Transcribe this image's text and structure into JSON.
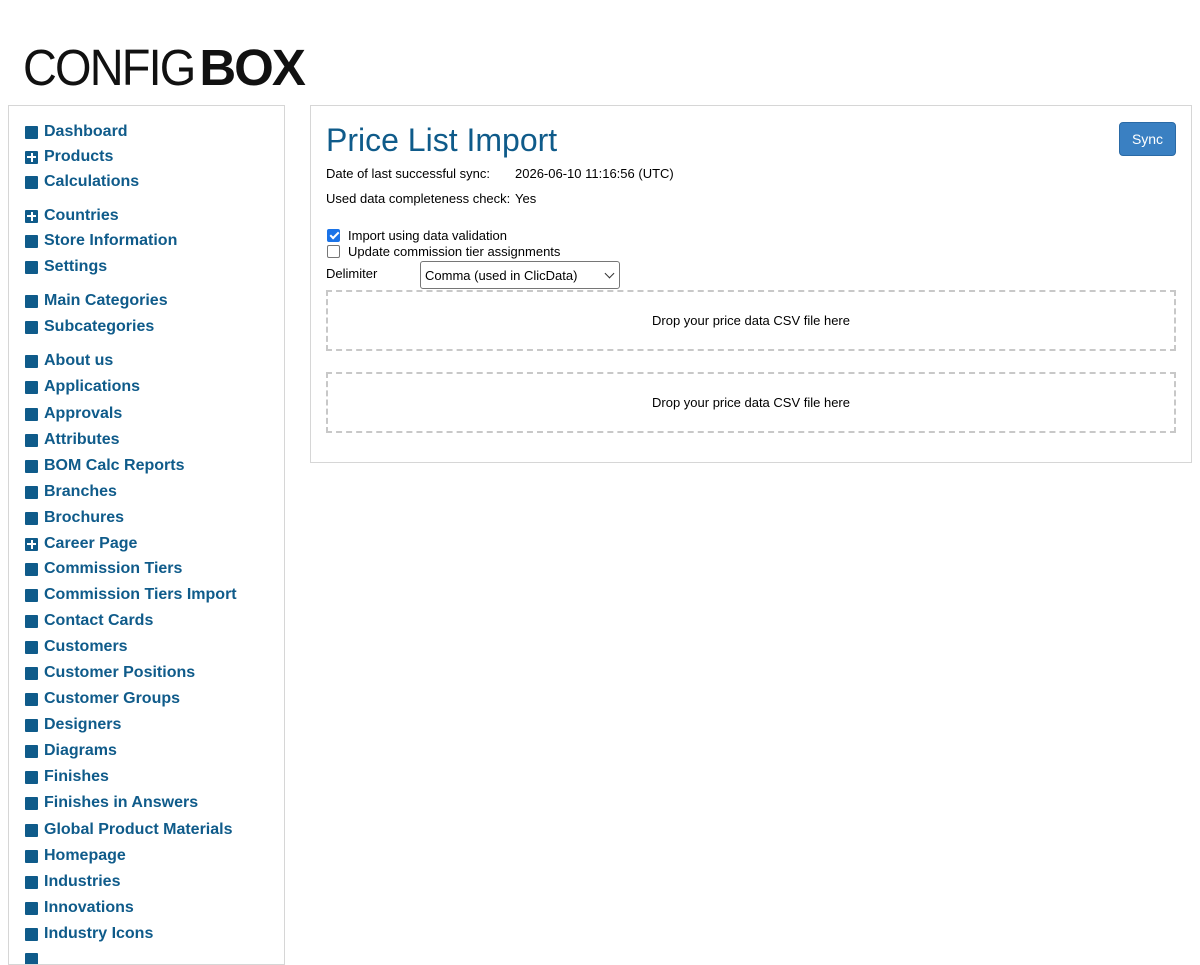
{
  "logo": {
    "light": "CONFIG",
    "bold": "BOX"
  },
  "sidebar": {
    "items": [
      {
        "label": "Dashboard",
        "icon": "square-icon"
      },
      {
        "label": "Products",
        "icon": "plus-icon"
      },
      {
        "label": "Calculations",
        "icon": "square-icon"
      },
      {
        "label": "Countries",
        "icon": "plus-icon"
      },
      {
        "label": "Store Information",
        "icon": "square-icon"
      },
      {
        "label": "Settings",
        "icon": "square-icon"
      },
      {
        "label": "Main Categories",
        "icon": "square-icon"
      },
      {
        "label": "Subcategories",
        "icon": "square-icon"
      },
      {
        "label": "About us",
        "icon": "square-icon"
      },
      {
        "label": "Applications",
        "icon": "square-icon"
      },
      {
        "label": "Approvals",
        "icon": "square-icon"
      },
      {
        "label": "Attributes",
        "icon": "square-icon"
      },
      {
        "label": "BOM Calc Reports",
        "icon": "square-icon"
      },
      {
        "label": "Branches",
        "icon": "square-icon"
      },
      {
        "label": "Brochures",
        "icon": "square-icon"
      },
      {
        "label": "Career Page",
        "icon": "plus-icon"
      },
      {
        "label": "Commission Tiers",
        "icon": "square-icon"
      },
      {
        "label": "Commission Tiers Import",
        "icon": "square-icon"
      },
      {
        "label": "Contact Cards",
        "icon": "square-icon"
      },
      {
        "label": "Customers",
        "icon": "square-icon"
      },
      {
        "label": "Customer Positions",
        "icon": "square-icon"
      },
      {
        "label": "Customer Groups",
        "icon": "square-icon"
      },
      {
        "label": "Designers",
        "icon": "square-icon"
      },
      {
        "label": "Diagrams",
        "icon": "square-icon"
      },
      {
        "label": "Finishes",
        "icon": "square-icon"
      },
      {
        "label": "Finishes in Answers",
        "icon": "square-icon"
      },
      {
        "label": "Global Product Materials",
        "icon": "square-icon"
      },
      {
        "label": "Homepage",
        "icon": "square-icon"
      },
      {
        "label": "Industries",
        "icon": "square-icon"
      },
      {
        "label": "Innovations",
        "icon": "square-icon"
      },
      {
        "label": "Industry Icons",
        "icon": "square-icon"
      }
    ]
  },
  "main": {
    "title": "Price List Import",
    "sync_label": "Sync",
    "last_sync_label": "Date of last successful sync:",
    "last_sync_value": "2026-06-10 11:16:56 (UTC)",
    "completeness_label": "Used data completeness check:",
    "completeness_value": "Yes",
    "checkbox_validation_label": "Import using data validation",
    "checkbox_validation_checked": true,
    "checkbox_commission_label": "Update commission tier assignments",
    "checkbox_commission_checked": false,
    "delimiter_label": "Delimiter",
    "delimiter_value": "Comma (used in ClicData)",
    "dropzone1_text": "Drop your price data CSV file here",
    "dropzone2_text": "Drop your price data CSV file here"
  },
  "colors": {
    "accent": "#0f5b8a",
    "button": "#3a80c2"
  }
}
